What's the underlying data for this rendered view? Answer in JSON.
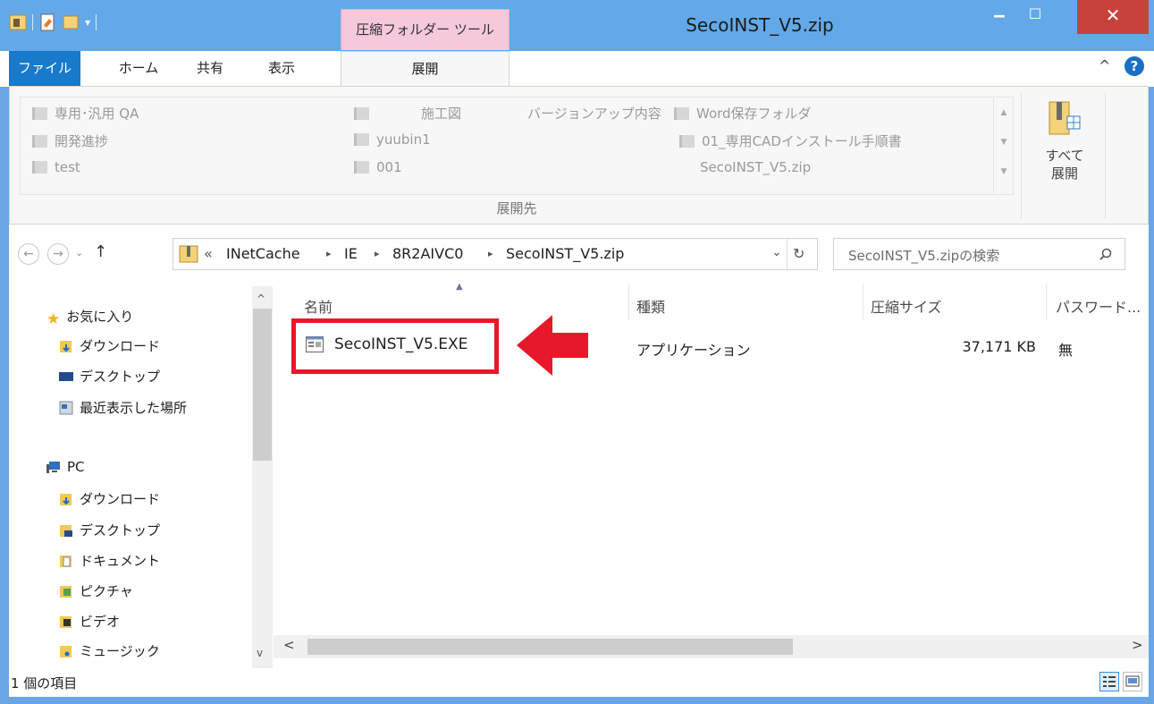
{
  "window": {
    "title": "SecoINST_V5.zip",
    "context_tab": "圧縮フォルダー ツール",
    "buttons": {
      "minimize": "‒",
      "maximize": "☐",
      "close": "✕"
    }
  },
  "ribbon": {
    "tabs": {
      "file": "ファイル",
      "home": "ホーム",
      "share": "共有",
      "view": "表示",
      "extract": "展開"
    },
    "collapse_glyph": "^",
    "help_glyph": "?",
    "destinations": [
      {
        "label": "専用･汎用  QA",
        "underline": "QA"
      },
      {
        "label": "開発進捗"
      },
      {
        "label": "test"
      },
      {
        "label": "施工図"
      },
      {
        "label": "yuubin1"
      },
      {
        "label": "001"
      },
      {
        "label": "バージョンアップ内容"
      },
      {
        "label": "Word保存フォルダ"
      },
      {
        "label": "01_専用CADインストール手順書"
      },
      {
        "label": "SecoINST_V5.zip"
      }
    ],
    "group_label": "展開先",
    "extract_all_line1": "すべて",
    "extract_all_line2": "展開"
  },
  "address": {
    "back": "←",
    "forward": "→",
    "dropdown": "⌄",
    "up": "↑",
    "prefix": "«",
    "crumbs": [
      "INetCache",
      "IE",
      "8R2AIVC0",
      "SecoINST_V5.zip"
    ],
    "separator": "▸",
    "history": "⌄",
    "refresh": "↻",
    "search_placeholder": "SecoINST_V5.zipの検索"
  },
  "nav": {
    "favorites": "お気に入り",
    "favorites_items": [
      "ダウンロード",
      "デスクトップ",
      "最近表示した場所"
    ],
    "pc": "PC",
    "pc_items": [
      "ダウンロード",
      "デスクトップ",
      "ドキュメント",
      "ピクチャ",
      "ビデオ",
      "ミュージック"
    ]
  },
  "columns": {
    "name": "名前",
    "type": "種類",
    "compressed": "圧縮サイズ",
    "password": "パスワード..."
  },
  "files": [
    {
      "name": "SecoINST_V5.EXE",
      "type": "アプリケーション",
      "size": "37,171 KB",
      "password": "無"
    }
  ],
  "status": {
    "count": "1 個の項目"
  },
  "colors": {
    "titlebar": "#63a9ea",
    "file_tab": "#1979ca",
    "context_tab": "#f5c8da",
    "close": "#c9413b",
    "highlight": "#e8182b"
  }
}
